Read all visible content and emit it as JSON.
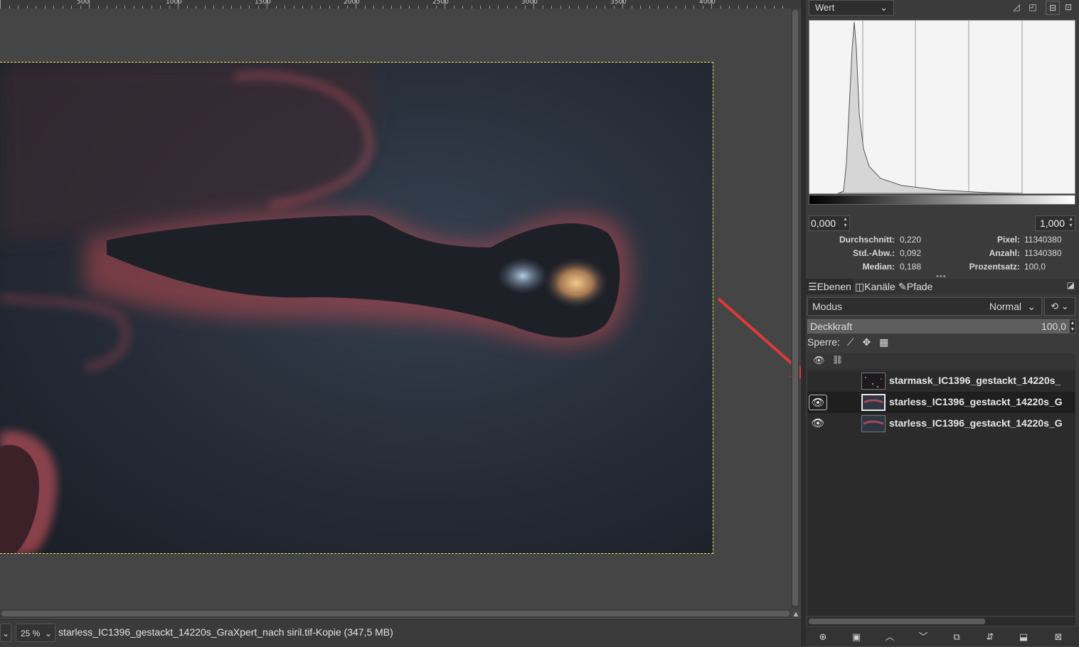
{
  "ruler": {
    "labels": [
      "500",
      "1000",
      "1500",
      "2000",
      "2500",
      "3000",
      "3500",
      "4000"
    ]
  },
  "image": {
    "description_colors": {
      "accent_red": "#d0454c"
    }
  },
  "statusbar": {
    "unit_dropdown": "",
    "zoom": "25 %",
    "title": "starless_IC1396_gestackt_14220s_GraXpert_nach siril.tif-Kopie (347,5 MB)"
  },
  "histogram": {
    "channel": "Wert",
    "min": "0,000",
    "max": "1,000",
    "stats": {
      "mean_label": "Durchschnitt:",
      "mean": "0,220",
      "std_label": "Std.-Abw.:",
      "std": "0,092",
      "median_label": "Median:",
      "median": "0,188",
      "pixels_label": "Pixel:",
      "pixels": "11340380",
      "count_label": "Anzahl:",
      "count": "11340380",
      "percent_label": "Prozentsatz:",
      "percent": "100,0"
    }
  },
  "tabs": [
    {
      "label": "Ebenen",
      "icon": "layers-icon"
    },
    {
      "label": "Kanäle",
      "icon": "channels-icon"
    },
    {
      "label": "Pfade",
      "icon": "paths-icon"
    }
  ],
  "layers_panel": {
    "mode_label": "Modus",
    "mode_value": "Normal",
    "opacity_label": "Deckkraft",
    "opacity_value": "100,0",
    "lock_label": "Sperre:"
  },
  "layers": [
    {
      "name": "starmask_IC1396_gestackt_14220s_",
      "visible": false,
      "selected": false
    },
    {
      "name": "starless_IC1396_gestackt_14220s_G",
      "visible": true,
      "selected": true
    },
    {
      "name": "starless_IC1396_gestackt_14220s_G",
      "visible": true,
      "selected": false
    }
  ],
  "colors": {
    "selection_border": "#e6e05a",
    "arrow": "#e03a3a"
  }
}
